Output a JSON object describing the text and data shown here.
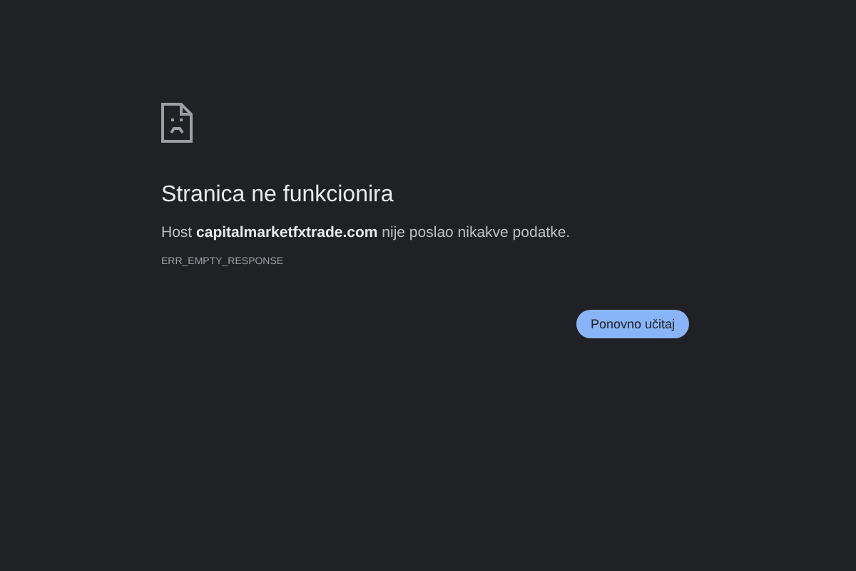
{
  "error": {
    "title": "Stranica ne funkcionira",
    "message": "Host **capitalmarketfxtrade.com** nije poslao nikakve podatke.",
    "code": "ERR_EMPTY_RESPONSE"
  },
  "buttons": [
    "Ponovno učitaj"
  ]
}
